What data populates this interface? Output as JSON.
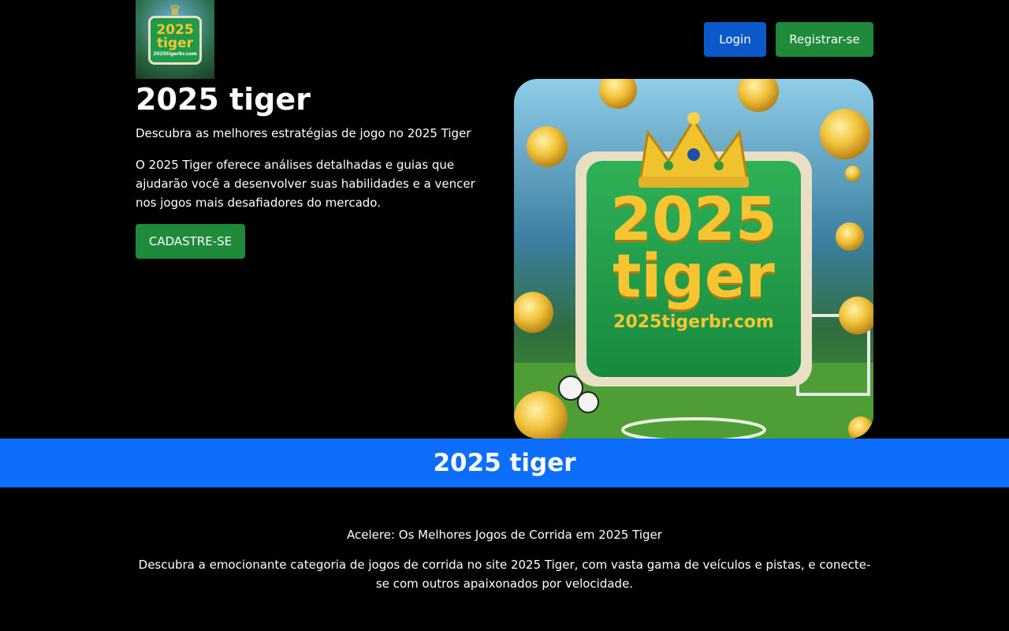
{
  "header": {
    "logo": {
      "line1": "2025",
      "line2": "tiger",
      "line3": "2025tigerbr.com"
    },
    "login_label": "Login",
    "register_label": "Registrar-se"
  },
  "hero": {
    "title": "2025 tiger",
    "subtitle": "Descubra as melhores estratégias de jogo no 2025 Tiger",
    "description": "O 2025 Tiger oferece análises detalhadas e guias que ajudarão você a desenvolver suas habilidades e a vencer nos jogos mais desafiadores do mercado.",
    "cta_label": "CADASTRE-SE",
    "image": {
      "line1": "2025",
      "line2": "tiger",
      "line3": "2025tigerbr.com"
    }
  },
  "banner": {
    "title": "2025 tiger"
  },
  "section": {
    "title": "Acelere: Os Melhores Jogos de Corrida em 2025 Tiger",
    "text": "Descubra a emocionante categoria de jogos de corrida no site 2025 Tiger, com vasta gama de veículos e pistas, e conecte-se com outros apaixonados por velocidade."
  },
  "colors": {
    "background": "#000000",
    "login_button": "#0a58ca",
    "register_button": "#1e8a3a",
    "banner": "#0d6efd",
    "logo_green": "#1f9a48",
    "logo_gold": "#f6c531"
  }
}
